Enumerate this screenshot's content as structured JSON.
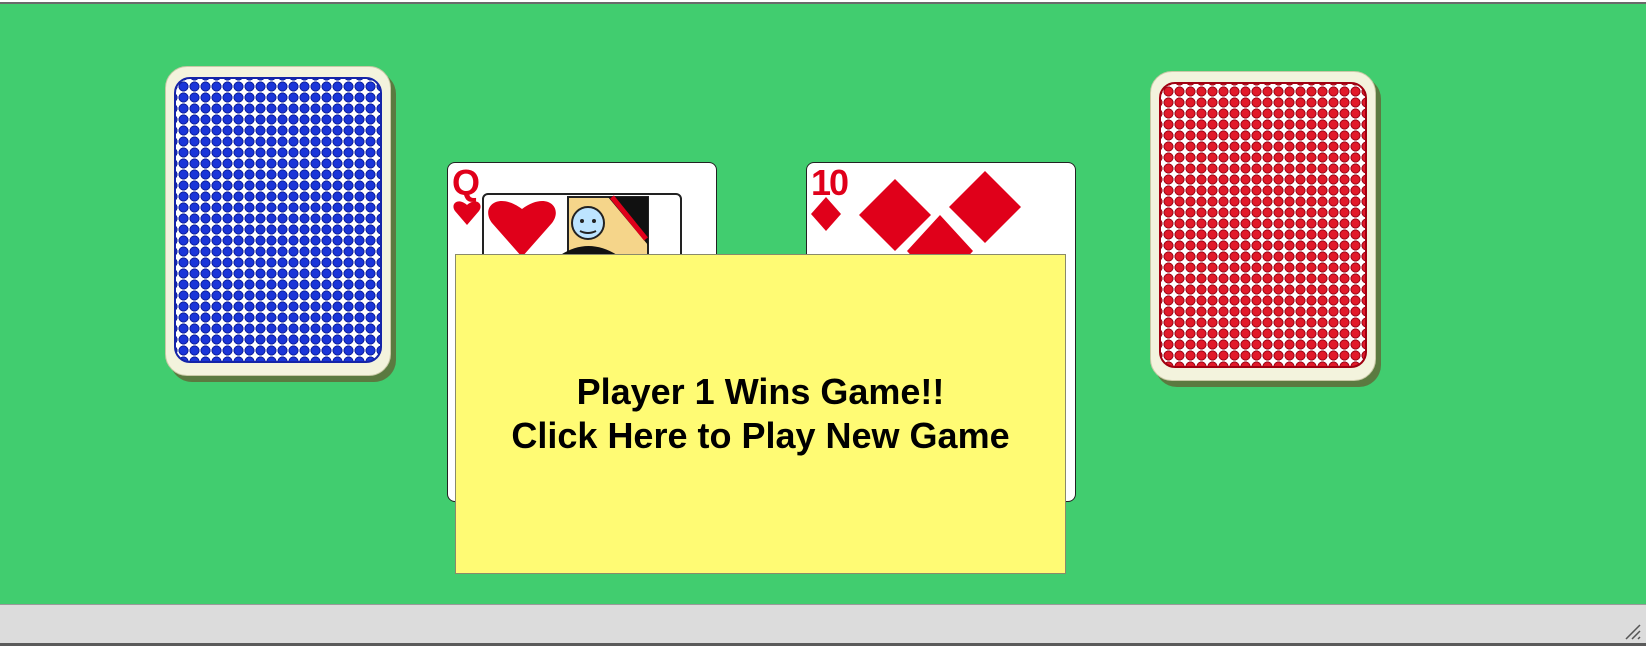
{
  "game": {
    "player1_deck": {
      "back_color": "#1a35d9"
    },
    "player2_deck": {
      "back_color": "#e21a2a"
    },
    "played_cards": [
      {
        "rank": "Q",
        "suit": "hearts",
        "color": "#e0001a"
      },
      {
        "rank": "10",
        "suit": "diamonds",
        "color": "#e0001a"
      }
    ],
    "message": {
      "line1": "Player 1 Wins Game!!",
      "line2": "Click Here to Play New Game",
      "background": "#fffb74"
    }
  },
  "colors": {
    "table": "#41cd6f",
    "statusbar": "#dcdcdc"
  }
}
